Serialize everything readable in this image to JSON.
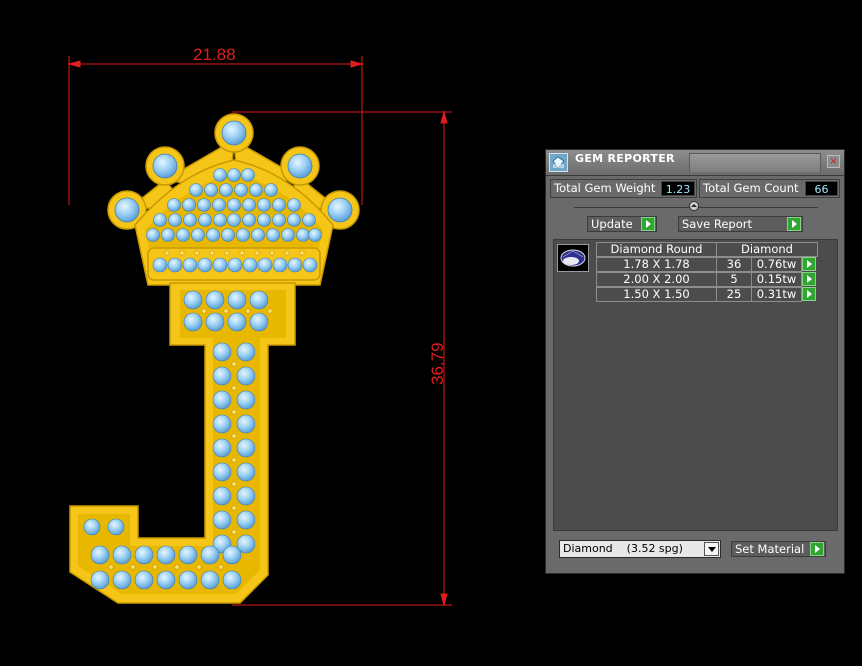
{
  "drawing": {
    "width_dimension": "21.88",
    "height_dimension": "36.79",
    "dimension_color": "#e11d1d",
    "metal_color": "#f5c518",
    "stone_color": "#8ec8f0"
  },
  "gem_reporter": {
    "title": "GEM REPORTER",
    "close_icon": "×",
    "total_weight_label": "Total Gem Weight",
    "total_weight_value": "1.23",
    "total_count_label": "Total Gem Count",
    "total_count_value": "66",
    "update_label": "Update",
    "save_report_label": "Save Report",
    "table": {
      "headers": [
        "Diamond Round",
        "Diamond"
      ],
      "rows": [
        {
          "size": "1.78 X 1.78",
          "count": "36",
          "weight": "0.76tw"
        },
        {
          "size": "2.00 X 2.00",
          "count": "5",
          "weight": "0.15tw"
        },
        {
          "size": "1.50 X 1.50",
          "count": "25",
          "weight": "0.31tw"
        }
      ]
    },
    "material_selected": "Diamond    (3.52 spg)",
    "set_material_label": "Set Material",
    "accent_play_color": "#2fa62f"
  }
}
